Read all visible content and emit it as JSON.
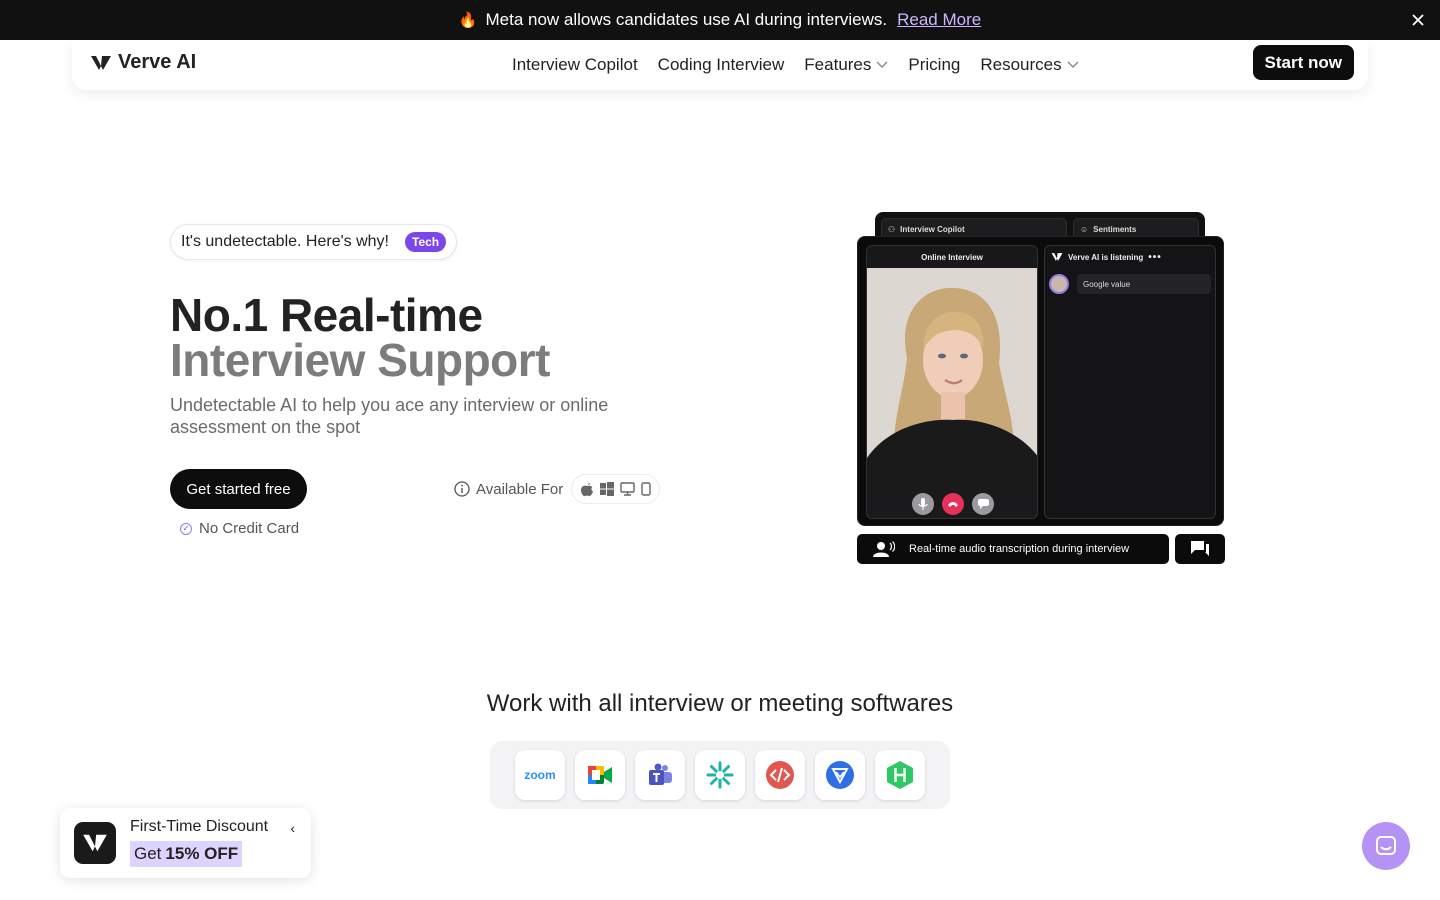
{
  "announcement": {
    "text": "Meta now allows candidates use AI during interviews.",
    "link": "Read More"
  },
  "nav": {
    "brand": "Verve AI",
    "items": [
      "Interview Copilot",
      "Coding Interview",
      "Features",
      "Pricing",
      "Resources"
    ],
    "cta": "Start now"
  },
  "hero": {
    "pill_text": "It's undetectable. Here's why!",
    "pill_tag": "Tech",
    "title_line1": "No.1 Real-time",
    "title_line2": "Interview Support",
    "subtitle": "Undetectable AI to help you ace any interview or online assessment on the spot",
    "cta": "Get started free",
    "no_credit": "No Credit Card",
    "available_for": "Available For",
    "platform_icons": [
      "apple-icon",
      "windows-icon",
      "desktop-icon",
      "mobile-icon"
    ]
  },
  "mockup": {
    "tab_copilot": "Interview Copilot",
    "tab_sentiments": "Sentiments",
    "left_title": "Online Interview",
    "right_title": "Verve AI is listening",
    "message": "Google value",
    "caption": "Real-time audio transcription during interview"
  },
  "integrations": {
    "heading": "Work with all interview or meeting softwares",
    "apps": [
      "zoom",
      "google-meet-icon",
      "teams-icon",
      "star-app-icon",
      "code-app-icon",
      "shield-app-icon",
      "hackerrank-icon"
    ]
  },
  "discount": {
    "title": "First-Time Discount",
    "get": "Get",
    "amount": "15% OFF"
  },
  "colors": {
    "accent": "#7a48e8",
    "dark": "#0d0d0d",
    "highlight": "#ddd3ff",
    "chat": "#b493f5"
  }
}
